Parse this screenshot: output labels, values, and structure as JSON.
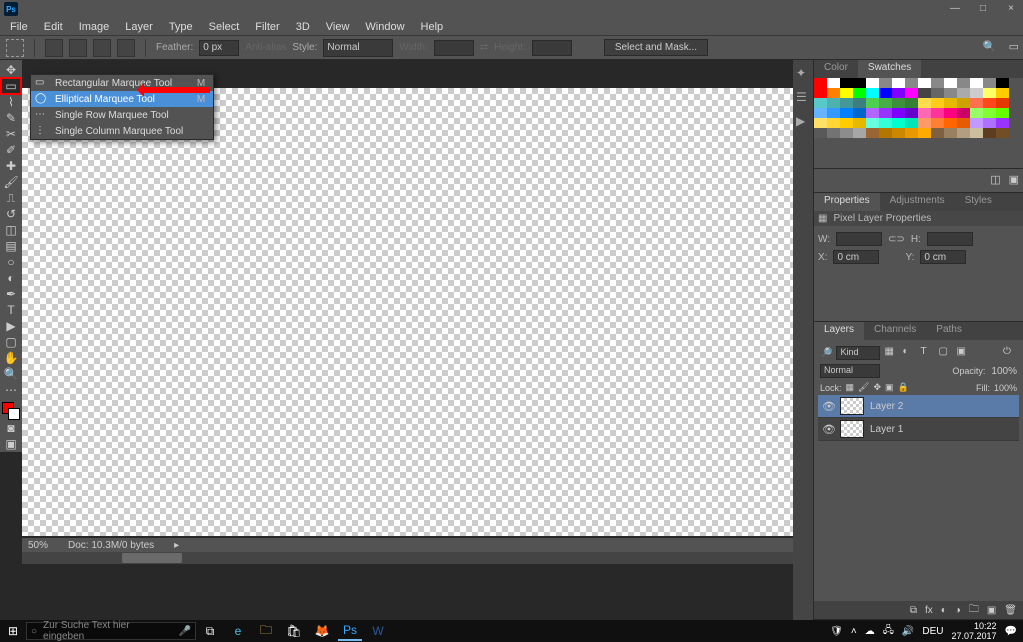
{
  "app": {
    "name": "Ps"
  },
  "window_controls": {
    "min": "—",
    "max": "□",
    "close": "×"
  },
  "menus": [
    "File",
    "Edit",
    "Image",
    "Layer",
    "Type",
    "Select",
    "Filter",
    "3D",
    "View",
    "Window",
    "Help"
  ],
  "options": {
    "feather_label": "Feather:",
    "feather_value": "0 px",
    "antialias": "Anti-alias",
    "style_label": "Style:",
    "style_value": "Normal",
    "width_label": "Width:",
    "height_label": "Height:",
    "mask_btn": "Select and Mask..."
  },
  "tool_flyout": {
    "items": [
      {
        "label": "Rectangular Marquee Tool",
        "shortcut": "M",
        "hl": false
      },
      {
        "label": "Elliptical Marquee Tool",
        "shortcut": "M",
        "hl": true
      },
      {
        "label": "Single Row Marquee Tool",
        "shortcut": "",
        "hl": false
      },
      {
        "label": "Single Column Marquee Tool",
        "shortcut": "",
        "hl": false
      }
    ]
  },
  "status": {
    "zoom": "50%",
    "doc": "Doc: 10.3M/0 bytes"
  },
  "doc_winbtns": {
    "min": "—",
    "max": "□",
    "close": "×"
  },
  "panels": {
    "color_tab": "Color",
    "swatches_tab": "Swatches",
    "props_tab": "Properties",
    "adjust_tab": "Adjustments",
    "styles_tab": "Styles",
    "props_header": "Pixel Layer Properties",
    "props": {
      "w_lbl": "W:",
      "h_lbl": "H:",
      "x_lbl": "X:",
      "y_lbl": "Y:",
      "x_val": "0 cm",
      "y_val": "0 cm",
      "link": "⊂⊃"
    },
    "layers_tab": "Layers",
    "channels_tab": "Channels",
    "paths_tab": "Paths",
    "layer_filter": {
      "kind": "Kind"
    },
    "layer_mode": {
      "mode": "Normal",
      "opacity_lbl": "Opacity:",
      "opacity_val": "100%",
      "fill_lbl": "Fill:",
      "fill_val": "100%",
      "lock_lbl": "Lock:"
    },
    "layers": [
      {
        "name": "Layer 2"
      },
      {
        "name": "Layer 1"
      }
    ]
  },
  "swatch_colors": [
    "#ff0000",
    "#ffffff",
    "#000000",
    "#000000",
    "#ffffff",
    "#888888",
    "#ffffff",
    "#888888",
    "#ffffff",
    "#888888",
    "#ffffff",
    "#888888",
    "#ffffff",
    "#888888",
    "#000000",
    "#ff0000",
    "#ff8000",
    "#ffff00",
    "#00ff00",
    "#00ffff",
    "#0000ff",
    "#8000ff",
    "#ff00ff",
    "#444444",
    "#666666",
    "#888888",
    "#aaaaaa",
    "#cccccc",
    "#ffff66",
    "#ffcc00",
    "#58c9c9",
    "#4fb0b0",
    "#469797",
    "#3d7e7e",
    "#4fcf4f",
    "#46b046",
    "#3d913d",
    "#348034",
    "#ffdb4d",
    "#ffcc1a",
    "#e6b800",
    "#cca300",
    "#ff704d",
    "#ff471a",
    "#e63900",
    "#66b3ff",
    "#3399ff",
    "#0080ff",
    "#0066cc",
    "#b366ff",
    "#9933ff",
    "#8000ff",
    "#6600cc",
    "#ff66b3",
    "#ff3399",
    "#ff0080",
    "#cc0066",
    "#99ff66",
    "#80ff33",
    "#66ff00",
    "#ffe066",
    "#ffd633",
    "#ffcc00",
    "#e6b800",
    "#66ffe0",
    "#33ffd6",
    "#00ffcc",
    "#00e6b8",
    "#ff9966",
    "#ff8033",
    "#ff6600",
    "#e65c00",
    "#c299ff",
    "#ad70ff",
    "#9933ff",
    "#595959",
    "#737373",
    "#8c8c8c",
    "#a6a6a6",
    "#996633",
    "#b37700",
    "#cc8800",
    "#e69900",
    "#ffaa00",
    "#806040",
    "#998060",
    "#b39f7f",
    "#ccbf9f",
    "#5c3d1f",
    "#734d26"
  ],
  "taskbar": {
    "search_placeholder": "Zur Suche Text hier eingeben",
    "lang": "DEU",
    "time": "10:22",
    "date": "27.07.2017"
  }
}
